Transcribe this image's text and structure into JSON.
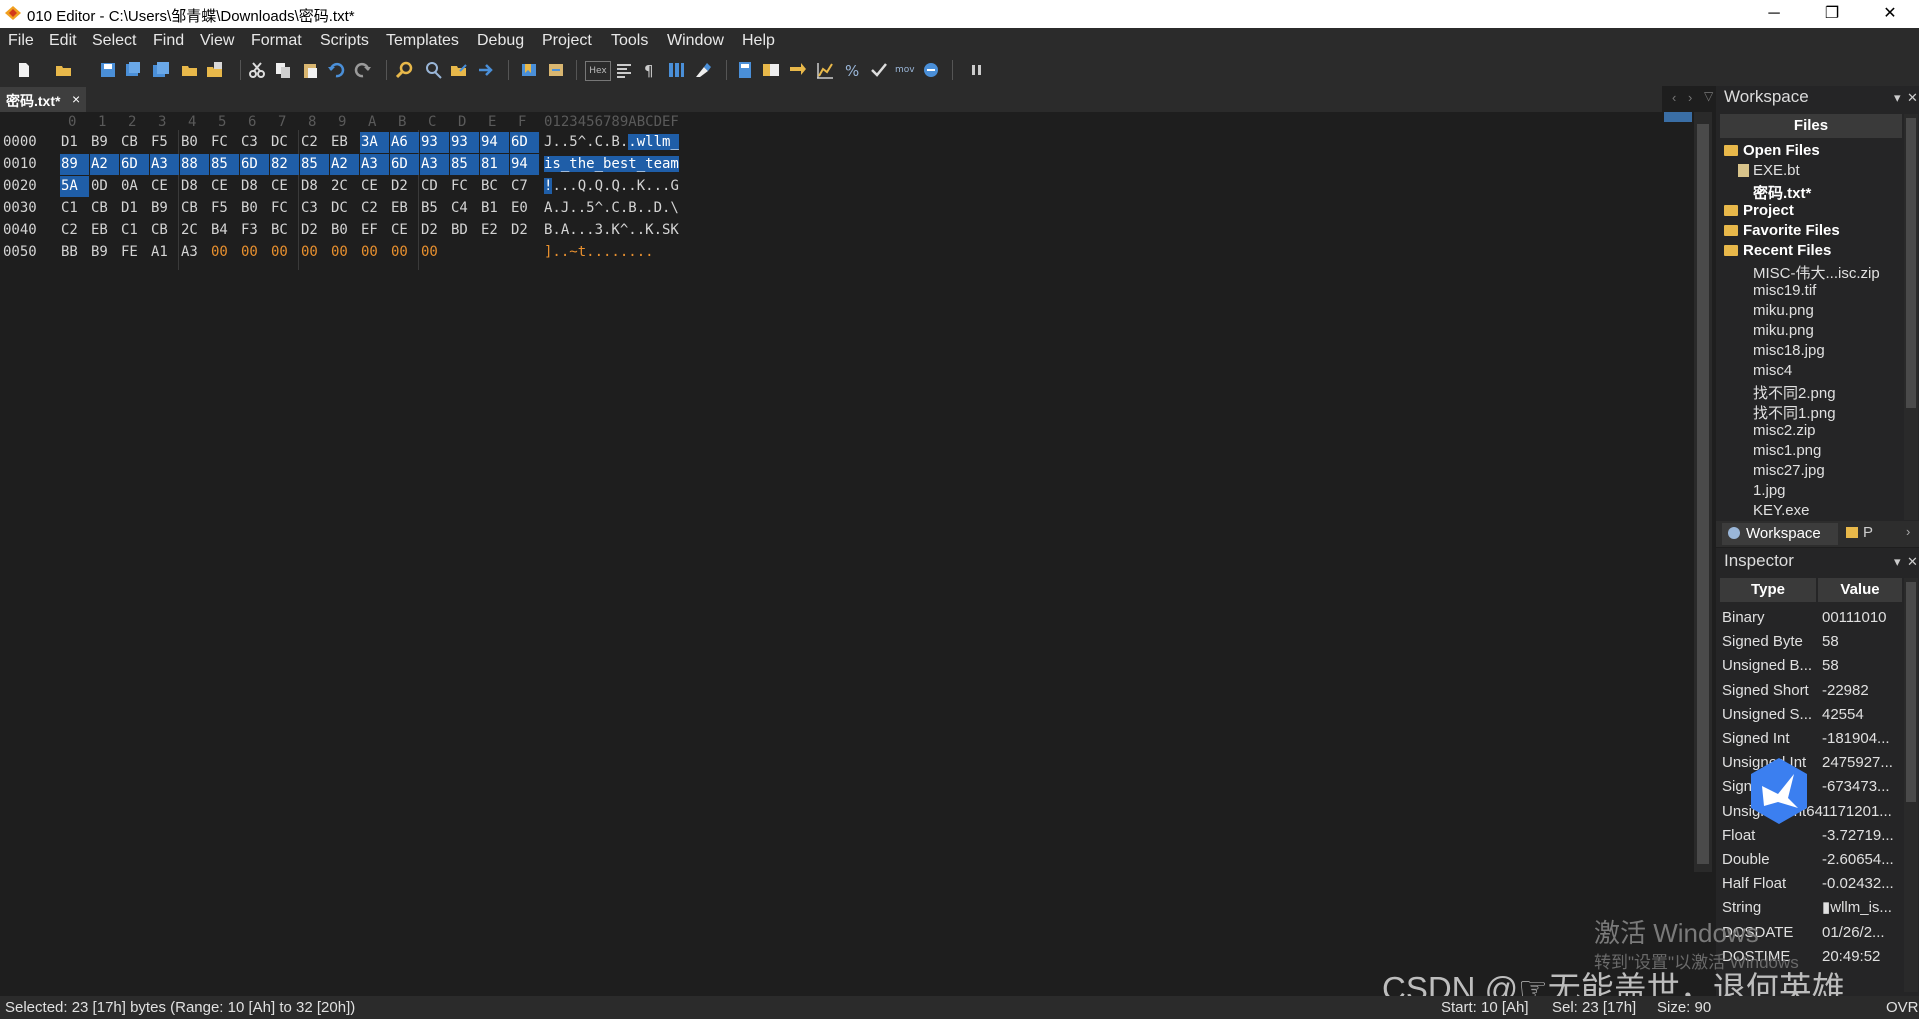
{
  "window": {
    "title": "010 Editor - C:\\Users\\邹青蝶\\Downloads\\密码.txt*",
    "minimize": "─",
    "restore": "❐",
    "close": "✕"
  },
  "menu": [
    "File",
    "Edit",
    "Select",
    "Find",
    "View",
    "Format",
    "Scripts",
    "Templates",
    "Debug",
    "Project",
    "Tools",
    "Window",
    "Help"
  ],
  "toolbar": {
    "hex_label": "Hex",
    "mov_label": "mov"
  },
  "tab": {
    "label": "密码.txt*",
    "close": "×"
  },
  "hex": {
    "columns": [
      "0",
      "1",
      "2",
      "3",
      "4",
      "5",
      "6",
      "7",
      "8",
      "9",
      "A",
      "B",
      "C",
      "D",
      "E",
      "F"
    ],
    "ascii_header": "0123456789ABCDEF",
    "rows": [
      {
        "addr": "0000",
        "bytes": [
          "D1",
          "B9",
          "CB",
          "F5",
          "B0",
          "FC",
          "C3",
          "DC",
          "C2",
          "EB",
          "3A",
          "A6",
          "93",
          "93",
          "94",
          "6D"
        ],
        "ascii_plain": "J..5^.C.B.",
        "ascii_sel": ".wllm_"
      },
      {
        "addr": "0010",
        "bytes": [
          "89",
          "A2",
          "6D",
          "A3",
          "88",
          "85",
          "6D",
          "82",
          "85",
          "A2",
          "A3",
          "6D",
          "A3",
          "85",
          "81",
          "94"
        ],
        "ascii_plain": "",
        "ascii_sel": "is_the_best_team"
      },
      {
        "addr": "0020",
        "bytes": [
          "5A",
          "0D",
          "0A",
          "CE",
          "D8",
          "CE",
          "D8",
          "CE",
          "D8",
          "2C",
          "CE",
          "D2",
          "CD",
          "FC",
          "BC",
          "C7"
        ],
        "ascii_sel": "!",
        "ascii_plain": "...Q.Q.Q..K...G"
      },
      {
        "addr": "0030",
        "bytes": [
          "C1",
          "CB",
          "D1",
          "B9",
          "CB",
          "F5",
          "B0",
          "FC",
          "C3",
          "DC",
          "C2",
          "EB",
          "B5",
          "C4",
          "B1",
          "E0"
        ],
        "ascii_plain": "A.J..5^.C.B..D.\\",
        "ascii_sel": ""
      },
      {
        "addr": "0040",
        "bytes": [
          "C2",
          "EB",
          "C1",
          "CB",
          "2C",
          "B4",
          "F3",
          "BC",
          "D2",
          "B0",
          "EF",
          "CE",
          "D2",
          "BD",
          "E2",
          "D2"
        ],
        "ascii_plain": "B.A...3.K^..K.SK",
        "ascii_sel": ""
      },
      {
        "addr": "0050",
        "bytes": [
          "BB",
          "B9",
          "FE",
          "A1",
          "A3",
          "00",
          "00",
          "00",
          "00",
          "00",
          "00",
          "00",
          "00"
        ],
        "ascii_plain": "]..~t........",
        "ascii_sel": ""
      }
    ]
  },
  "workspace": {
    "title": "Workspace",
    "column_header": "Files",
    "open_files": "Open Files",
    "open_items": [
      "EXE.bt",
      "密码.txt*"
    ],
    "project": "Project",
    "favorite_files": "Favorite Files",
    "recent_files": "Recent Files",
    "recent_items": [
      "MISC-伟大...isc.zip",
      "misc19.tif",
      "miku.png",
      "miku.png",
      "misc18.jpg",
      "misc4",
      "找不同2.png",
      "找不同1.png",
      "misc2.zip",
      "misc1.png",
      "misc27.jpg",
      "1.jpg",
      "KEY.exe"
    ],
    "tab_workspace": "Workspace",
    "tab_project": "P"
  },
  "inspector": {
    "title": "Inspector",
    "col_type": "Type",
    "col_value": "Value",
    "rows": [
      {
        "type": "Binary",
        "value": "00111010"
      },
      {
        "type": "Signed Byte",
        "value": "58"
      },
      {
        "type": "Unsigned B...",
        "value": "58"
      },
      {
        "type": "Signed Short",
        "value": "-22982"
      },
      {
        "type": "Unsigned S...",
        "value": "42554"
      },
      {
        "type": "Signed Int",
        "value": "-181904..."
      },
      {
        "type": "Unsigned Int",
        "value": "2475927..."
      },
      {
        "type": "Signed Int64",
        "value": "-673473..."
      },
      {
        "type": "Unsigned Int64",
        "value": "1171201..."
      },
      {
        "type": "Float",
        "value": "-3.72719..."
      },
      {
        "type": "Double",
        "value": "-2.60654..."
      },
      {
        "type": "Half Float",
        "value": "-0.02432..."
      },
      {
        "type": "String",
        "value": "▮wllm_is..."
      },
      {
        "type": "DOSDATE",
        "value": "01/26/2..."
      },
      {
        "type": "DOSTIME",
        "value": "20:49:52"
      }
    ]
  },
  "status": {
    "selected": "Selected: 23 [17h] bytes (Range: 10 [Ah] to 32 [20h])",
    "start": "Start: 10 [Ah]",
    "sel": "Sel: 23 [17h]",
    "size": "Size: 90",
    "mode": "OVR"
  },
  "overlay": {
    "watermark_line1": "激活 Windows",
    "watermark_line2": "转到\"设置\"以激活 Windows",
    "csdn": "CSDN @☞无能盖世，退何英雄"
  },
  "colors": {
    "selection": "#1f5ea8",
    "zero_bytes": "#e8902f",
    "folder": "#e8b84a"
  }
}
